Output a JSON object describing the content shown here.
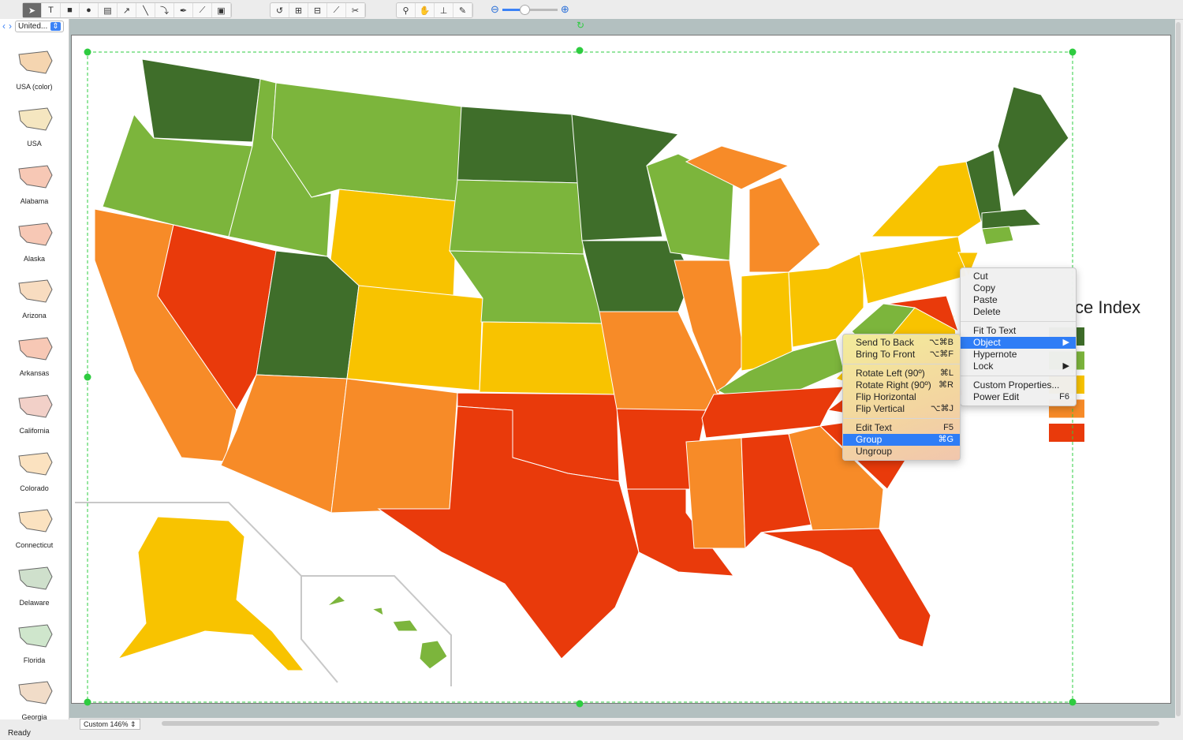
{
  "toolbar": {
    "groups": [
      [
        "pointer-tool",
        "text-tool",
        "rectangle-tool",
        "ellipse-tool",
        "table-tool",
        "arrow-tool",
        "line-tool",
        "arc-tool",
        "pen-tool",
        "bezier-tool",
        "container-tool"
      ],
      [
        "rotate-tool",
        "group-tool",
        "ungroup-tool",
        "connect-tool",
        "scissors-tool"
      ],
      [
        "zoom-tool",
        "hand-tool",
        "stamp-tool",
        "eyedropper-tool"
      ]
    ],
    "zoom_level": 0.38
  },
  "sidebar": {
    "library": "United...",
    "items": [
      "USA (color)",
      "USA",
      "Alabama",
      "Alaska",
      "Arizona",
      "Arkansas",
      "California",
      "Colorado",
      "Connecticut",
      "Delaware",
      "Florida",
      "Georgia"
    ]
  },
  "legend": {
    "title": "ce Index",
    "colors": [
      "#3f6e2a",
      "#7cb53c",
      "#f8c300",
      "#f78b28",
      "#e93a0b"
    ]
  },
  "context_menu": {
    "items": [
      {
        "label": "Cut"
      },
      {
        "label": "Copy"
      },
      {
        "label": "Paste"
      },
      {
        "label": "Delete"
      },
      {
        "sep": true
      },
      {
        "label": "Fit To Text"
      },
      {
        "label": "Object",
        "submenu": true,
        "highlighted": true
      },
      {
        "label": "Hypernote"
      },
      {
        "label": "Lock",
        "submenu": true
      },
      {
        "sep": true
      },
      {
        "label": "Custom Properties..."
      },
      {
        "label": "Power Edit",
        "shortcut": "F6"
      }
    ]
  },
  "submenu": {
    "items": [
      {
        "label": "Send To Back",
        "shortcut": "⌥⌘B"
      },
      {
        "label": "Bring To Front",
        "shortcut": "⌥⌘F"
      },
      {
        "sep": true
      },
      {
        "label": "Rotate Left (90º)",
        "shortcut": "⌘L"
      },
      {
        "label": "Rotate Right (90º)",
        "shortcut": "⌘R"
      },
      {
        "label": "Flip Horizontal"
      },
      {
        "label": "Flip Vertical",
        "shortcut": "⌥⌘J"
      },
      {
        "sep": true
      },
      {
        "label": "Edit Text",
        "shortcut": "F5"
      },
      {
        "label": "Group",
        "shortcut": "⌘G",
        "highlighted": true
      },
      {
        "label": "Ungroup"
      }
    ]
  },
  "bottom": {
    "zoom": "Custom 146%",
    "status": "Ready"
  },
  "colors": {
    "dark_green": "#3f6e2a",
    "green": "#7cb53c",
    "yellow": "#f8c300",
    "orange": "#f78b28",
    "red": "#e93a0b",
    "selection": "#2ecc40"
  }
}
